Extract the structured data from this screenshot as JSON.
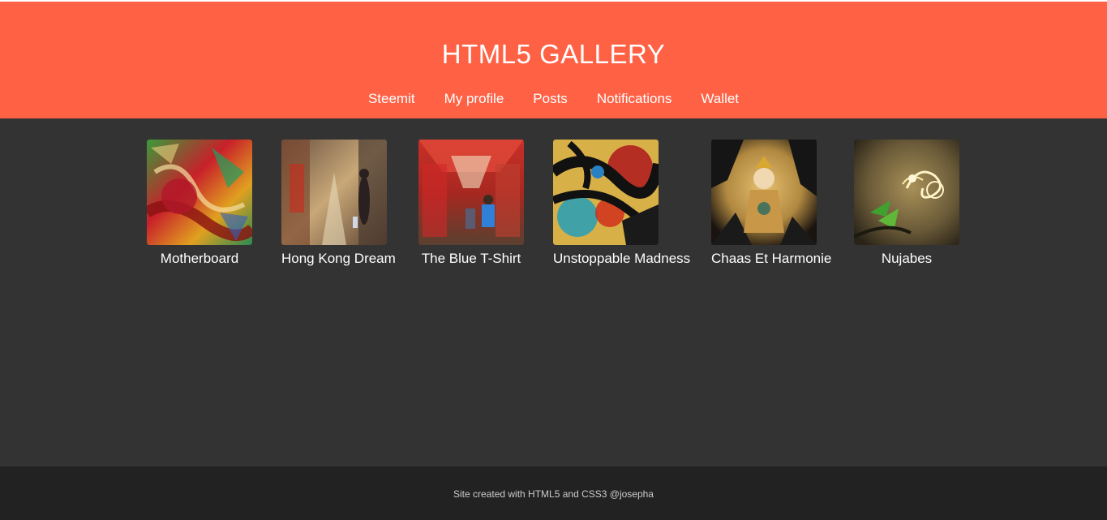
{
  "header": {
    "title": "HTML5 GALLERY",
    "background": "#ff6145"
  },
  "nav": {
    "items": [
      {
        "label": "Steemit"
      },
      {
        "label": "My profile"
      },
      {
        "label": "Posts"
      },
      {
        "label": "Notifications"
      },
      {
        "label": "Wallet"
      }
    ]
  },
  "gallery": {
    "items": [
      {
        "caption": "Motherboard"
      },
      {
        "caption": "Hong Kong Dream"
      },
      {
        "caption": "The Blue T-Shirt"
      },
      {
        "caption": "Unstoppable Madness"
      },
      {
        "caption": "Chaas Et Harmonie"
      },
      {
        "caption": "Nujabes"
      }
    ]
  },
  "footer": {
    "text": "Site created with HTML5 and CSS3 @josepha"
  },
  "colors": {
    "header_bg": "#ff6145",
    "main_bg": "#333333",
    "footer_bg": "#222222",
    "text": "#ffffff"
  }
}
